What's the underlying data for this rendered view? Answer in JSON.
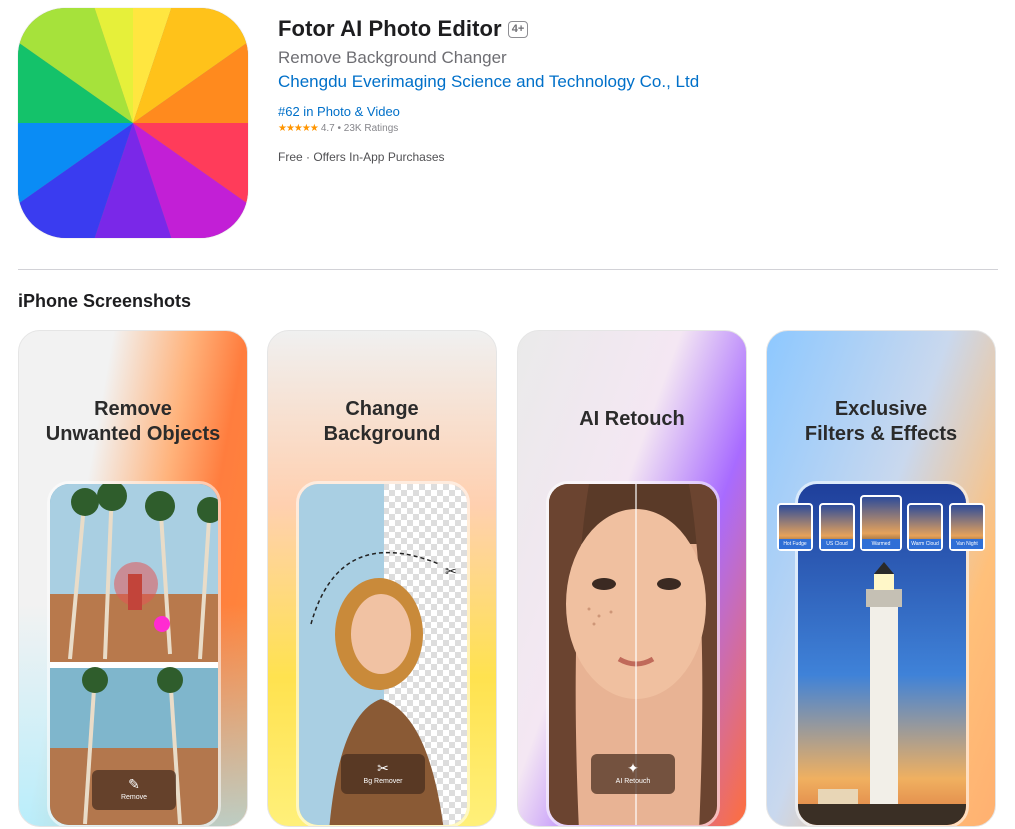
{
  "app": {
    "title": "Fotor AI Photo Editor",
    "age_rating": "4+",
    "subtitle": "Remove Background Changer",
    "developer": "Chengdu Everimaging Science and Technology Co., Ltd",
    "rank": "#62 in Photo & Video",
    "stars": "★★★★★",
    "rating": "4.7 • 23K Ratings",
    "price": "Free · Offers In-App Purchases"
  },
  "screenshots": {
    "section_title": "iPhone Screenshots",
    "items": [
      {
        "heading_line1": "Remove",
        "heading_line2": "Unwanted Objects",
        "tool_label": "Remove",
        "tool_icon": "eraser-icon"
      },
      {
        "heading_line1": "Change",
        "heading_line2": "Background",
        "tool_label": "Bg Remover",
        "tool_icon": "scissors-icon"
      },
      {
        "heading_line1": "AI Retouch",
        "tool_label": "AI Retouch",
        "tool_icon": "retouch-icon"
      },
      {
        "heading_line1": "Exclusive",
        "heading_line2": "Filters & Effects",
        "filters": [
          "Hot Fudge",
          "US Cloud",
          "Warmed",
          "Warm Cloud",
          "Van Night"
        ]
      }
    ]
  },
  "colors": {
    "link": "#0070c9",
    "star": "#ff9500",
    "text": "#1d1d1f",
    "secondary": "#6e6e73"
  }
}
